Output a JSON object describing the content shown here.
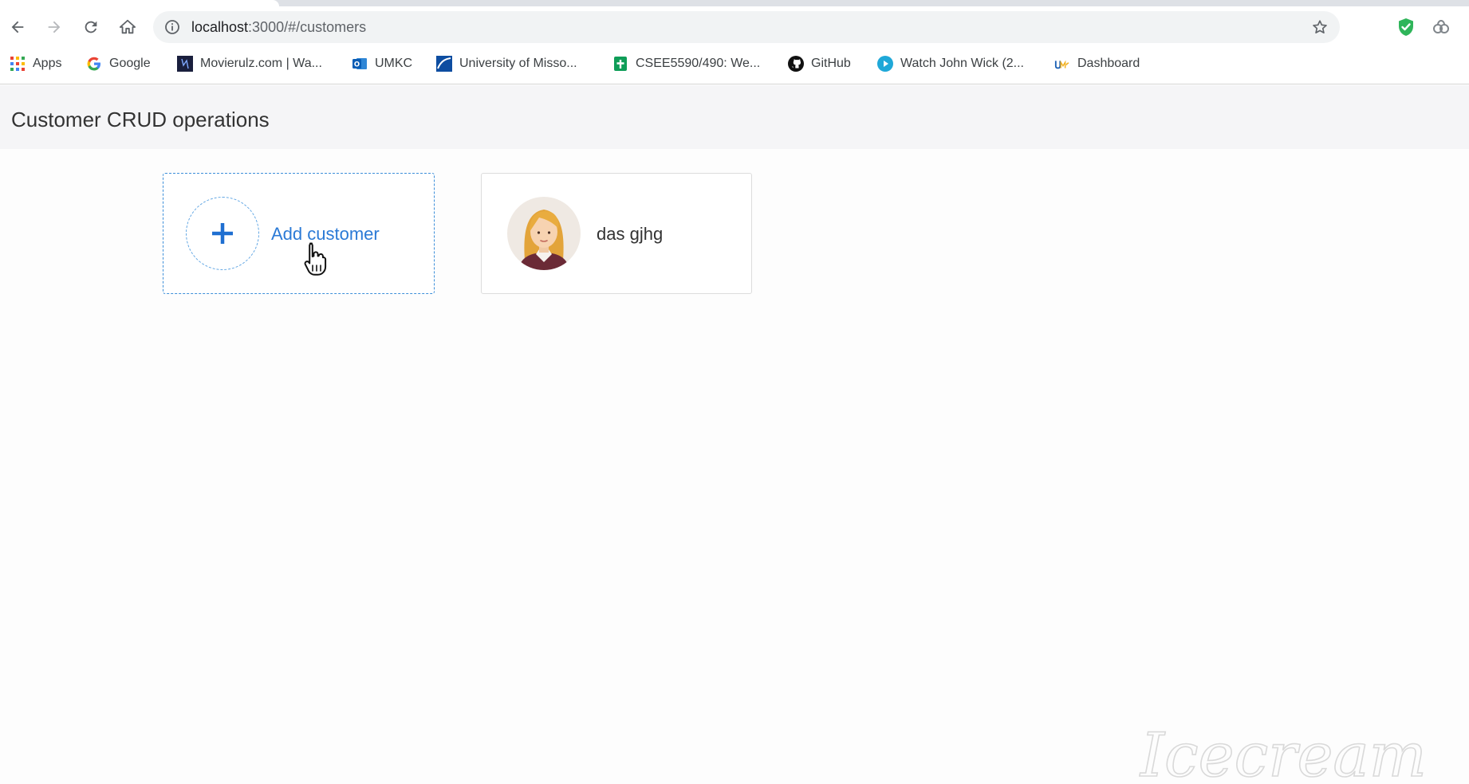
{
  "browser": {
    "url_host": "localhost",
    "url_rest": ":3000/#/customers",
    "bookmarks": [
      {
        "label": "Apps"
      },
      {
        "label": "Google"
      },
      {
        "label": "Movierulz.com | Wa..."
      },
      {
        "label": "UMKC"
      },
      {
        "label": "University of Misso..."
      },
      {
        "label": "CSEE5590/490: We..."
      },
      {
        "label": "GitHub"
      },
      {
        "label": "Watch John Wick (2..."
      },
      {
        "label": "Dashboard"
      }
    ]
  },
  "app": {
    "title": "Customer CRUD operations",
    "add_card": {
      "label": "Add customer"
    },
    "customers": [
      {
        "name": "das gjhg"
      }
    ]
  },
  "watermark": {
    "text": "Icecream"
  },
  "colors": {
    "accent": "#2b7ad6",
    "dashed_border": "#3d8fd9",
    "header_bg": "#f5f5f7"
  },
  "icons": [
    "back-icon",
    "forward-icon",
    "reload-icon",
    "home-icon",
    "info-icon",
    "star-icon",
    "shield-extension-icon",
    "extension-icon",
    "apps-grid-icon",
    "google-icon",
    "movierulz-icon",
    "outlook-icon",
    "university-icon",
    "sheets-icon",
    "github-icon",
    "play-icon",
    "umkc-icon",
    "plus-icon",
    "hand-cursor-icon"
  ]
}
